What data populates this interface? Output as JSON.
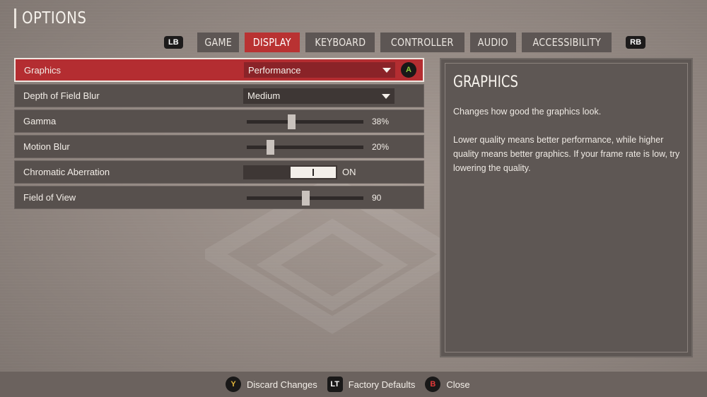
{
  "header": {
    "title": "OPTIONS"
  },
  "tabs": {
    "left_bumper": "LB",
    "right_bumper": "RB",
    "items": [
      {
        "label": "GAME",
        "active": false
      },
      {
        "label": "DISPLAY",
        "active": true
      },
      {
        "label": "KEYBOARD",
        "active": false
      },
      {
        "label": "CONTROLLER",
        "active": false
      },
      {
        "label": "AUDIO",
        "active": false
      },
      {
        "label": "ACCESSIBILITY",
        "active": false
      }
    ]
  },
  "settings": {
    "graphics": {
      "label": "Graphics",
      "value": "Performance",
      "confirm_button": "A"
    },
    "depth_of_field": {
      "label": "Depth of Field Blur",
      "value": "Medium"
    },
    "gamma": {
      "label": "Gamma",
      "value_text": "38%",
      "level": 0.38
    },
    "motion_blur": {
      "label": "Motion Blur",
      "value_text": "20%",
      "level": 0.2
    },
    "chromatic_aberration": {
      "label": "Chromatic Aberration",
      "state": "ON"
    },
    "field_of_view": {
      "label": "Field of View",
      "value_text": "90",
      "level": 0.5
    }
  },
  "description": {
    "title": "GRAPHICS",
    "line1": "Changes how good the graphics look.",
    "line2": "Lower quality means better performance, while higher quality means better graphics. If your frame rate is low, try lowering the quality."
  },
  "footer": {
    "discard": {
      "button": "Y",
      "label": "Discard Changes"
    },
    "defaults": {
      "button": "LT",
      "label": "Factory Defaults"
    },
    "close": {
      "button": "B",
      "label": "Close"
    }
  },
  "colors": {
    "accent": "#b93232",
    "row": "#57504d",
    "panel": "#5e5754",
    "background": "#958a84"
  }
}
